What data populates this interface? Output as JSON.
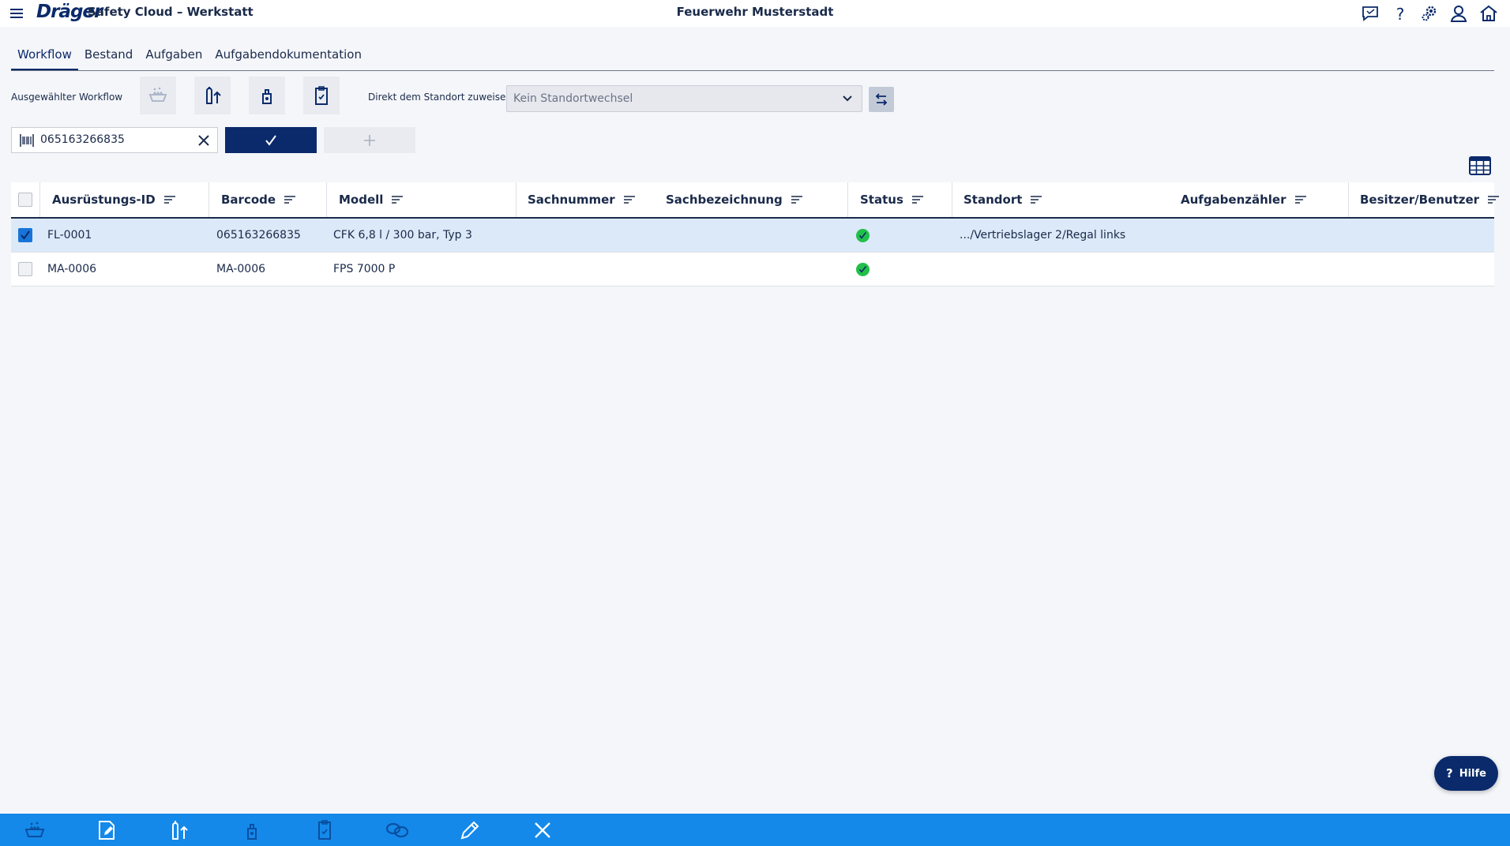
{
  "header": {
    "logo": "Dräger",
    "app_title": "Safety Cloud – Werkstatt",
    "org_title": "Feuerwehr Musterstadt",
    "icons": [
      "feedback-icon",
      "help-icon",
      "settings-icon",
      "user-icon",
      "home-icon"
    ]
  },
  "tabs": [
    {
      "label": "Workflow",
      "active": true
    },
    {
      "label": "Bestand",
      "active": false
    },
    {
      "label": "Aufgaben",
      "active": false
    },
    {
      "label": "Aufgabendokumentation",
      "active": false
    }
  ],
  "workflow": {
    "label": "Ausgewählter Workflow",
    "buttons": [
      "wash-basin-icon",
      "cylinder-fill-icon",
      "mask-test-icon",
      "clipboard-icon"
    ]
  },
  "location": {
    "label": "Direkt dem Standort zuweisen",
    "selected": "Kein Standortwechsel"
  },
  "barcode": {
    "value": "065163266835"
  },
  "table": {
    "columns": [
      "Ausrüstungs-ID",
      "Barcode",
      "Modell",
      "Sachnummer",
      "Sachbezeichnung",
      "Status",
      "Standort",
      "Aufgabenzähler",
      "Besitzer/Benutzer"
    ],
    "rows": [
      {
        "selected": true,
        "id": "FL-0001",
        "barcode": "065163266835",
        "model": "CFK 6,8 l / 300 bar, Typ 3",
        "sachnummer": "",
        "sachbezeichnung": "",
        "status": "ok",
        "standort": ".../Vertriebslager 2/Regal links",
        "aufgabenzaehler": "",
        "besitzer": ""
      },
      {
        "selected": false,
        "id": "MA-0006",
        "barcode": "MA-0006",
        "model": "FPS 7000 P",
        "sachnummer": "",
        "sachbezeichnung": "",
        "status": "ok",
        "standort": "",
        "aufgabenzaehler": "",
        "besitzer": ""
      }
    ]
  },
  "help": {
    "label": "Hilfe",
    "symbol": "?"
  },
  "bottom_toolbar": [
    "wash-basin-icon",
    "document-edit-icon",
    "cylinder-fill-icon",
    "mask-test-icon",
    "clipboard-icon",
    "link-icon",
    "pencil-icon",
    "close-icon"
  ],
  "colors": {
    "brand": "#0a2a6b",
    "toolbar": "#1489ea",
    "selected_row": "#dce9f8",
    "status_ok": "#21c04a"
  }
}
